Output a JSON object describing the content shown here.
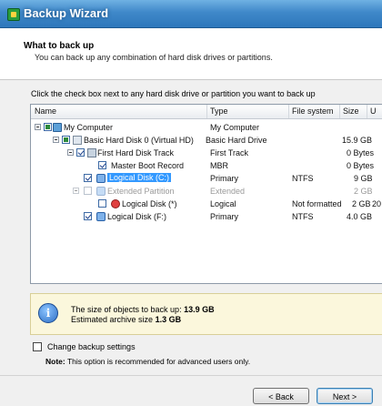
{
  "window": {
    "title": "Backup Wizard"
  },
  "header": {
    "title": "What to back up",
    "subtitle": "You can back up any combination of hard disk drives or partitions."
  },
  "instruction": "Click the check box next to any hard disk drive or partition you want to back up",
  "tree": {
    "columns": [
      "Name",
      "Type",
      "File system",
      "Size",
      "U"
    ],
    "rows": [
      {
        "name": "My Computer",
        "type": "My Computer",
        "fs": "",
        "size": ""
      },
      {
        "name": "Basic Hard Disk 0 (Virtual HD)",
        "type": "Basic Hard Drive",
        "fs": "",
        "size": "15.9 GB"
      },
      {
        "name": "First Hard Disk Track",
        "type": "First Track",
        "fs": "",
        "size": "0 Bytes"
      },
      {
        "name": "Master Boot Record",
        "type": "MBR",
        "fs": "",
        "size": "0 Bytes"
      },
      {
        "name": "Logical Disk (C:)",
        "type": "Primary",
        "fs": "NTFS",
        "size": "9 GB"
      },
      {
        "name": "Extended Partition",
        "type": "Extended",
        "fs": "",
        "size": "2 GB"
      },
      {
        "name": "Logical Disk (*)",
        "type": "Logical",
        "fs": "Not formatted",
        "size": "2 GB",
        "used": "20"
      },
      {
        "name": "Logical Disk (F:)",
        "type": "Primary",
        "fs": "NTFS",
        "size": "4.0 GB"
      }
    ]
  },
  "info": {
    "size_label": "The size of objects to back up:",
    "size_value": "13.9 GB",
    "archive_label": "Estimated archive size",
    "archive_value": "1.3 GB"
  },
  "options": {
    "change_settings_label": "Change backup settings",
    "note_label": "Note:",
    "note_text": "This option is recommended for advanced users only."
  },
  "buttons": {
    "back": "< Back",
    "next": "Next >"
  }
}
